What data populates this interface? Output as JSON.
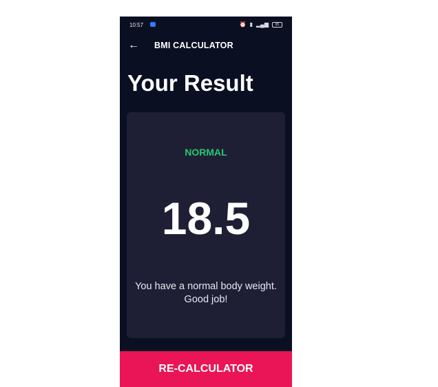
{
  "status_bar": {
    "time": "10:57",
    "icons": [
      "message-icon",
      "alarm-icon",
      "volte-icon",
      "signal-icon",
      "battery-icon"
    ],
    "battery": "85"
  },
  "appbar": {
    "back_icon": "arrow-left-icon",
    "title": "BMI CALCULATOR"
  },
  "page": {
    "title": "Your Result"
  },
  "result": {
    "status": "NORMAL",
    "value": "18.5",
    "message": "You have a normal body weight. Good job!"
  },
  "action": {
    "label": "RE-CALCULATOR"
  },
  "colors": {
    "background": "#0b0f22",
    "card": "#1e1f34",
    "status_green": "#27c871",
    "button": "#ea1556"
  }
}
